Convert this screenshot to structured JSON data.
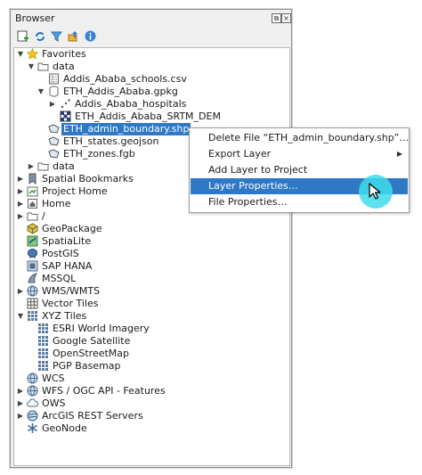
{
  "window": {
    "title": "Browser"
  },
  "toolbar": {
    "buttons": [
      {
        "icon": "add-selected-layers-icon"
      },
      {
        "icon": "refresh-icon"
      },
      {
        "icon": "filter-icon"
      },
      {
        "icon": "collapse-all-icon"
      },
      {
        "icon": "info-icon"
      }
    ]
  },
  "tree": {
    "favorites": "Favorites",
    "data1": "data",
    "schools_csv": "Addis_Ababa_schools.csv",
    "gpkg": "ETH_Addis_Ababa.gpkg",
    "hospitals": "Addis_Ababa_hospitals",
    "srtm": "ETH_Addis_Ababa_SRTM_DEM",
    "admin_boundary": "ETH_admin_boundary.shp",
    "states_geojson": "ETH_states.geojson",
    "zones_fgb": "ETH_zones.fgb",
    "data2": "data",
    "spatial_bookmarks": "Spatial Bookmarks",
    "project_home": "Project Home",
    "home": "Home",
    "root": "/",
    "geopackage": "GeoPackage",
    "spatialite": "SpatiaLite",
    "postgis": "PostGIS",
    "sap_hana": "SAP HANA",
    "mssql": "MSSQL",
    "wms_wmts": "WMS/WMTS",
    "vector_tiles": "Vector Tiles",
    "xyz_tiles": "XYZ Tiles",
    "esri": "ESRI World Imagery",
    "google": "Google Satellite",
    "osm": "OpenStreetMap",
    "pgp": "PGP Basemap",
    "wcs": "WCS",
    "wfs": "WFS / OGC API - Features",
    "ows": "OWS",
    "arcgis": "ArcGIS REST Servers",
    "geonode": "GeoNode"
  },
  "context_menu": {
    "delete": "Delete File “ETH_admin_boundary.shp”…",
    "export": "Export Layer",
    "add": "Add Layer to Project",
    "properties": "Layer Properties…",
    "file_properties": "File Properties…"
  },
  "colors": {
    "selection": "#2f78c6",
    "cursor_halo": "#40dceb"
  }
}
